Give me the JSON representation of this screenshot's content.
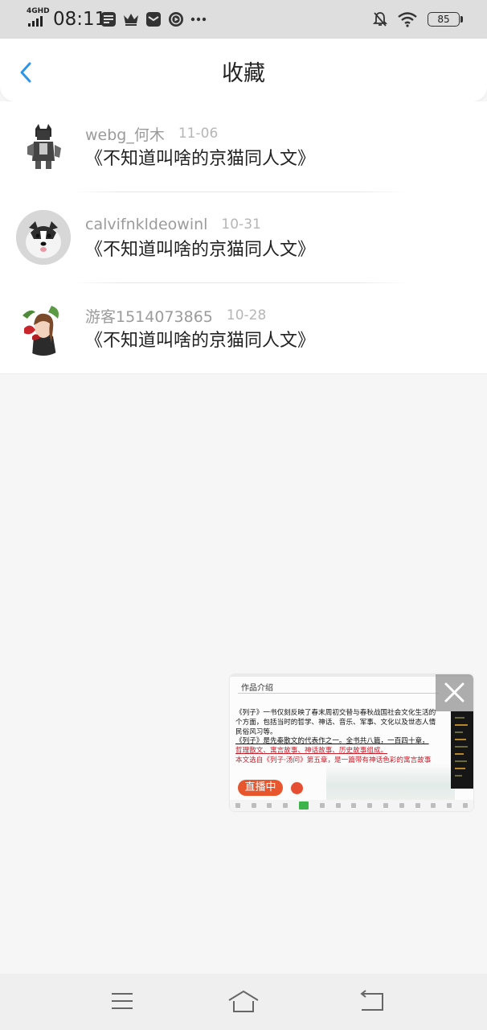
{
  "status_bar": {
    "network": "4GHD",
    "time": "08:11",
    "battery": "85",
    "icons": [
      "signal-icon",
      "sim-card-icon",
      "crown-icon",
      "mail-icon",
      "play-icon",
      "more-icon",
      "mute-bell-icon",
      "wifi-icon",
      "battery-icon"
    ]
  },
  "header": {
    "title": "收藏",
    "back_icon": "chevron-left-icon"
  },
  "colors": {
    "accent": "#2f95e8",
    "live_badge": "#e8562e",
    "live_text_red": "#c81f2b"
  },
  "favorites": [
    {
      "username": "webg_何木",
      "date": "11-06",
      "title": "《不知道叫啥的京猫同人文》"
    },
    {
      "username": "calvifnkldeowinl",
      "date": "10-31",
      "title": "《不知道叫啥的京猫同人文》"
    },
    {
      "username": "游客1514073865",
      "date": "10-28",
      "title": "《不知道叫啥的京猫同人文》"
    }
  ],
  "live_window": {
    "heading": "作品介绍",
    "lines": [
      "《列子》一书仅刻反映了春末周初交替与春秋战国社会文化生活的",
      "个方面，包括当时的哲学、神话、音乐、军事、文化以及世态人情",
      "民俗风习等。",
      "《列子》是先秦散文的代表作之一。全书共八篇，一百四十章，",
      "哲理散文、寓言故事、神话故事、历史故事组成。",
      "本文选自《列子·汤问》第五章，是一篇带有神话色彩的寓言故事"
    ],
    "badge": "直播中"
  },
  "nav_bar": {
    "items": [
      "menu-icon",
      "home-icon",
      "back-icon"
    ]
  }
}
